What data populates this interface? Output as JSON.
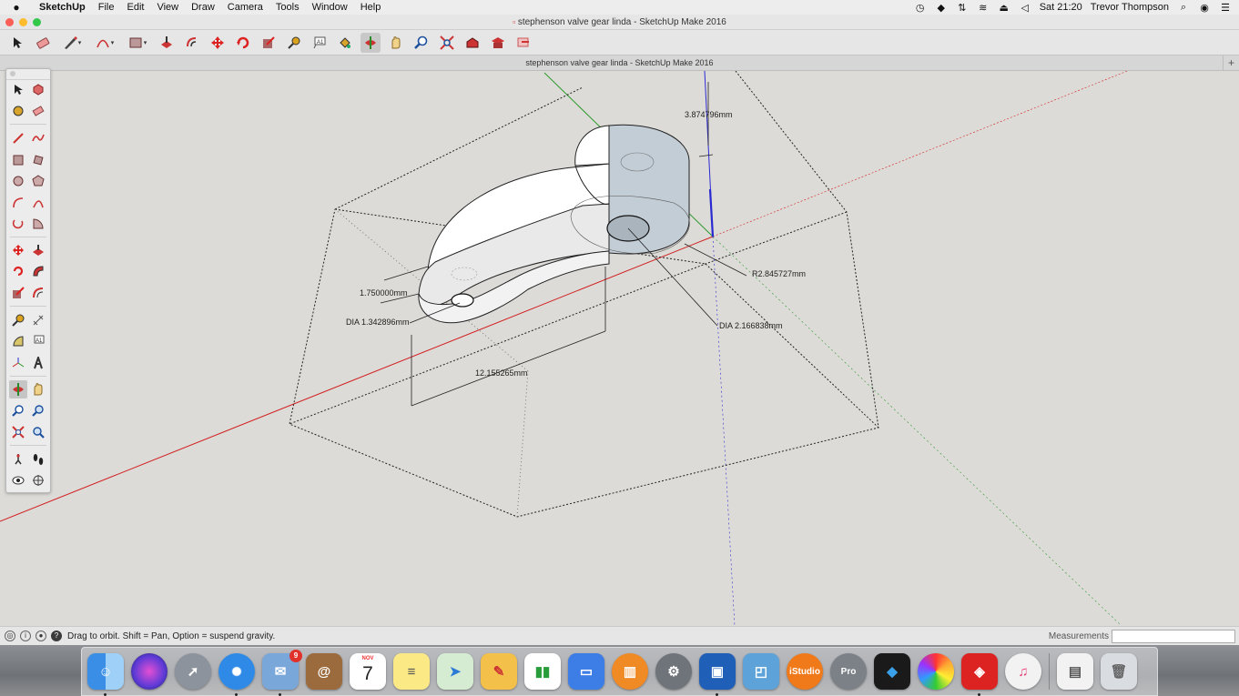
{
  "menubar": {
    "app_name": "SketchUp",
    "menus": [
      "File",
      "Edit",
      "View",
      "Draw",
      "Camera",
      "Tools",
      "Window",
      "Help"
    ],
    "clock": "Sat 21:20",
    "user": "Trevor Thompson"
  },
  "window": {
    "title": "stephenson valve gear linda - SketchUp Make 2016",
    "doc_tab": "stephenson valve gear linda - SketchUp Make 2016"
  },
  "dimensions": {
    "height_label": "3.874796mm",
    "radius_label": "R2.845727mm",
    "thickness_label": "1.750000mm",
    "small_dia_label": "DIA 1.342896mm",
    "large_dia_label": "DIA 2.166838mm",
    "length_label": "12.155265mm"
  },
  "status": {
    "hint": "Drag to orbit. Shift = Pan, Option = suspend gravity.",
    "measurements_label": "Measurements",
    "measurements_value": ""
  },
  "dock": {
    "mail_badge": "9",
    "calendar_month": "NOV",
    "calendar_day": "7",
    "istudio_label": "iStudio",
    "pro_label": "Pro"
  },
  "colors": {
    "background": "#dddbd7",
    "red_axis": "#d02020",
    "green_axis": "#2c9a2c",
    "blue_axis": "#2a2ad0",
    "face_shade": "#c3cdd6",
    "face_light": "#ffffff"
  }
}
